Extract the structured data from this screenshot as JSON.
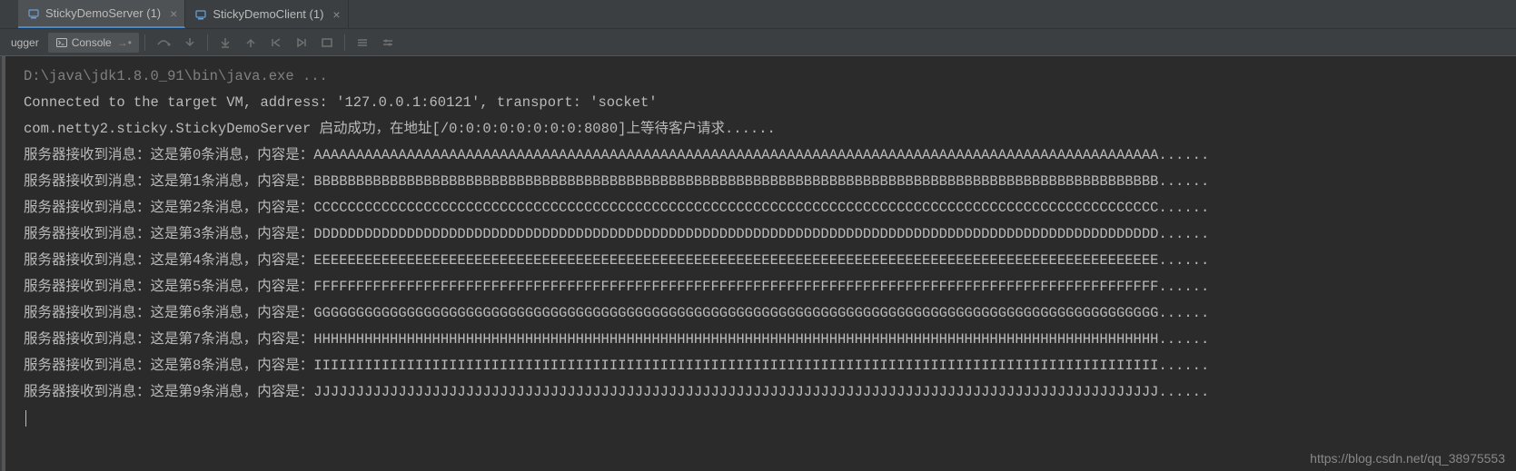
{
  "tabs": [
    {
      "label": "StickyDemoServer (1)",
      "active": true
    },
    {
      "label": "StickyDemoClient (1)",
      "active": false
    }
  ],
  "toolbar": {
    "debugger_label": "ugger",
    "console_label": "Console",
    "pin_icon": "pin-icon"
  },
  "console": {
    "cmd": "D:\\java\\jdk1.8.0_91\\bin\\java.exe ...",
    "connected": "Connected to the target VM, address: '127.0.0.1:60121', transport: 'socket'",
    "startup": "com.netty2.sticky.StickyDemoServer 启动成功，在地址[/0:0:0:0:0:0:0:0:8080]上等待客户请求......",
    "messages": [
      "服务器接收到消息：这是第0条消息，内容是：AAAAAAAAAAAAAAAAAAAAAAAAAAAAAAAAAAAAAAAAAAAAAAAAAAAAAAAAAAAAAAAAAAAAAAAAAAAAAAAAAAAAAAAAAAAAAAAAAAAA......",
      "服务器接收到消息：这是第1条消息，内容是：BBBBBBBBBBBBBBBBBBBBBBBBBBBBBBBBBBBBBBBBBBBBBBBBBBBBBBBBBBBBBBBBBBBBBBBBBBBBBBBBBBBBBBBBBBBBBBBBBBBB......",
      "服务器接收到消息：这是第2条消息，内容是：CCCCCCCCCCCCCCCCCCCCCCCCCCCCCCCCCCCCCCCCCCCCCCCCCCCCCCCCCCCCCCCCCCCCCCCCCCCCCCCCCCCCCCCCCCCCCCCCCCCC......",
      "服务器接收到消息：这是第3条消息，内容是：DDDDDDDDDDDDDDDDDDDDDDDDDDDDDDDDDDDDDDDDDDDDDDDDDDDDDDDDDDDDDDDDDDDDDDDDDDDDDDDDDDDDDDDDDDDDDDDDDDDD......",
      "服务器接收到消息：这是第4条消息，内容是：EEEEEEEEEEEEEEEEEEEEEEEEEEEEEEEEEEEEEEEEEEEEEEEEEEEEEEEEEEEEEEEEEEEEEEEEEEEEEEEEEEEEEEEEEEEEEEEEEEEE......",
      "服务器接收到消息：这是第5条消息，内容是：FFFFFFFFFFFFFFFFFFFFFFFFFFFFFFFFFFFFFFFFFFFFFFFFFFFFFFFFFFFFFFFFFFFFFFFFFFFFFFFFFFFFFFFFFFFFFFFFFFFF......",
      "服务器接收到消息：这是第6条消息，内容是：GGGGGGGGGGGGGGGGGGGGGGGGGGGGGGGGGGGGGGGGGGGGGGGGGGGGGGGGGGGGGGGGGGGGGGGGGGGGGGGGGGGGGGGGGGGGGGGGGGGG......",
      "服务器接收到消息：这是第7条消息，内容是：HHHHHHHHHHHHHHHHHHHHHHHHHHHHHHHHHHHHHHHHHHHHHHHHHHHHHHHHHHHHHHHHHHHHHHHHHHHHHHHHHHHHHHHHHHHHHHHHHHHH......",
      "服务器接收到消息：这是第8条消息，内容是：IIIIIIIIIIIIIIIIIIIIIIIIIIIIIIIIIIIIIIIIIIIIIIIIIIIIIIIIIIIIIIIIIIIIIIIIIIIIIIIIIIIIIIIIIIIIIIIIIIII......",
      "服务器接收到消息：这是第9条消息，内容是：JJJJJJJJJJJJJJJJJJJJJJJJJJJJJJJJJJJJJJJJJJJJJJJJJJJJJJJJJJJJJJJJJJJJJJJJJJJJJJJJJJJJJJJJJJJJJJJJJJJJ......"
    ]
  },
  "watermark": "https://blog.csdn.net/qq_38975553"
}
